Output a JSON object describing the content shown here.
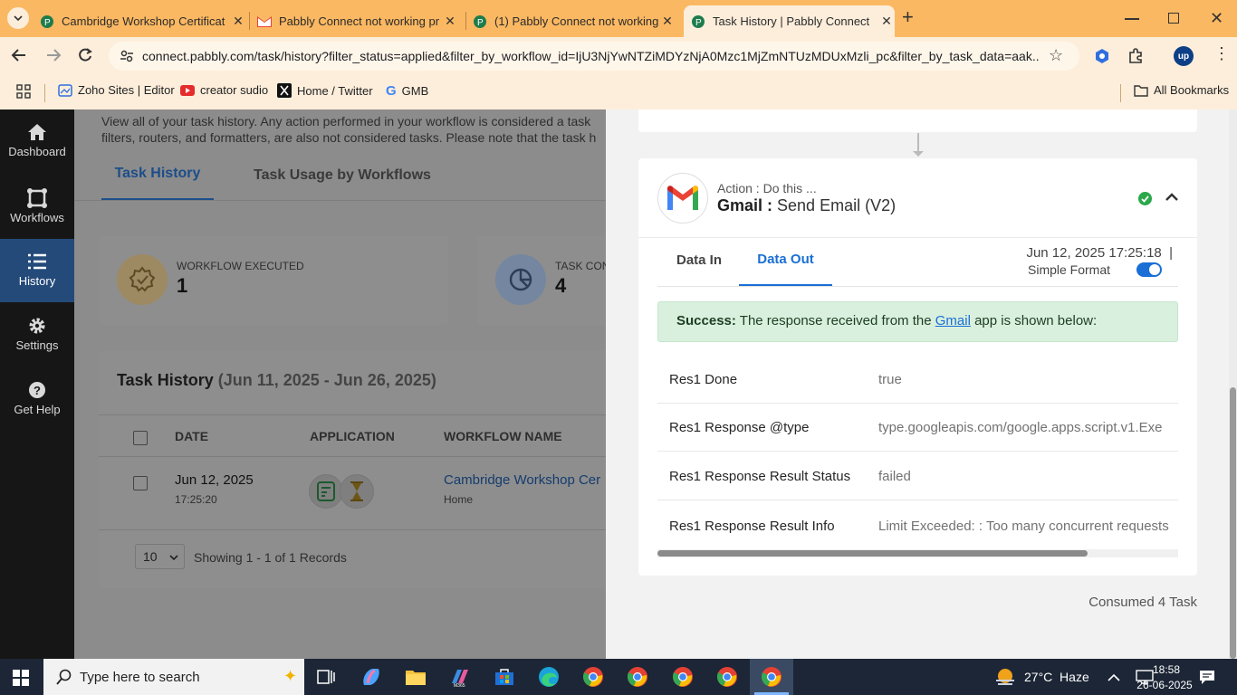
{
  "browser": {
    "tabs": [
      {
        "title": "Cambridge Workshop Certificat",
        "icon": "pabbly-icon"
      },
      {
        "title": "Pabbly Connect not working pr",
        "icon": "gmail-icon"
      },
      {
        "title": "(1) Pabbly Connect not working",
        "icon": "pabbly-icon"
      },
      {
        "title": "Task History | Pabbly Connect",
        "icon": "pabbly-icon",
        "active": true
      }
    ],
    "url": "connect.pabbly.com/task/history?filter_status=applied&filter_by_workflow_id=IjU3NjYwNTZiMDYzNjA0Mzc1MjZmNTUzMDUxMzli_pc&filter_by_task_data=aak...",
    "bookmarks": [
      "Zoho Sites | Editor",
      "creator sudio",
      "Home / Twitter",
      "GMB"
    ],
    "all_bookmarks": "All Bookmarks"
  },
  "sidebar": {
    "items": [
      {
        "label": "Dashboard",
        "icon": "home-icon"
      },
      {
        "label": "Workflows",
        "icon": "workflow-icon"
      },
      {
        "label": "History",
        "icon": "list-icon",
        "active": true
      },
      {
        "label": "Settings",
        "icon": "gear-icon"
      },
      {
        "label": "Get Help",
        "icon": "help-icon"
      }
    ]
  },
  "main": {
    "description_line1": "View all of your task history. Any action performed in your workflow is considered a task",
    "description_line2": "filters, routers, and formatters, are also not considered tasks. Please note that the task h",
    "tabs": [
      "Task History",
      "Task Usage by Workflows"
    ],
    "stats": [
      {
        "label": "WORKFLOW EXECUTED",
        "value": "1"
      },
      {
        "label": "TASK CON",
        "value": "4"
      }
    ],
    "table_title": "Task History",
    "table_range": "(Jun 11, 2025 - Jun 26, 2025)",
    "columns": [
      "DATE",
      "APPLICATION",
      "WORKFLOW NAME"
    ],
    "rows": [
      {
        "date": "Jun 12, 2025",
        "time": "17:25:20",
        "workflow": "Cambridge Workshop Cer",
        "folder": "Home"
      }
    ],
    "page_size": "10",
    "records": "Showing 1 - 1 of 1 Records"
  },
  "panel": {
    "step_label": "Action : Do this ...",
    "app_name": "Gmail :",
    "action_name": "Send Email (V2)",
    "tabs": [
      "Data In",
      "Data Out"
    ],
    "active_tab": "Data Out",
    "timestamp": "Jun 12, 2025 17:25:18",
    "separator": "|",
    "format_label": "Simple Format",
    "success_bold": "Success:",
    "success_pre": "The response received from the",
    "success_link": "Gmail",
    "success_post": "app is shown below:",
    "fields": [
      {
        "key": "Res1 Done",
        "value": "true"
      },
      {
        "key": "Res1 Response @type",
        "value": "type.googleapis.com/google.apps.script.v1.Exe"
      },
      {
        "key": "Res1 Response Result Status",
        "value": "failed"
      },
      {
        "key": "Res1 Response Result Info",
        "value": "Limit Exceeded: : Too many concurrent requests"
      }
    ],
    "consumed": "Consumed 4 Task"
  },
  "taskbar": {
    "search_placeholder": "Type here to search",
    "weather": "27°C  Haze",
    "time": "18:58",
    "date": "26-06-2025"
  },
  "colors": {
    "accent_blue": "#1a6fd6",
    "success_bg": "#d9f0de",
    "tabbar_bg": "#fbb862",
    "sidebar_bg": "#161616"
  }
}
